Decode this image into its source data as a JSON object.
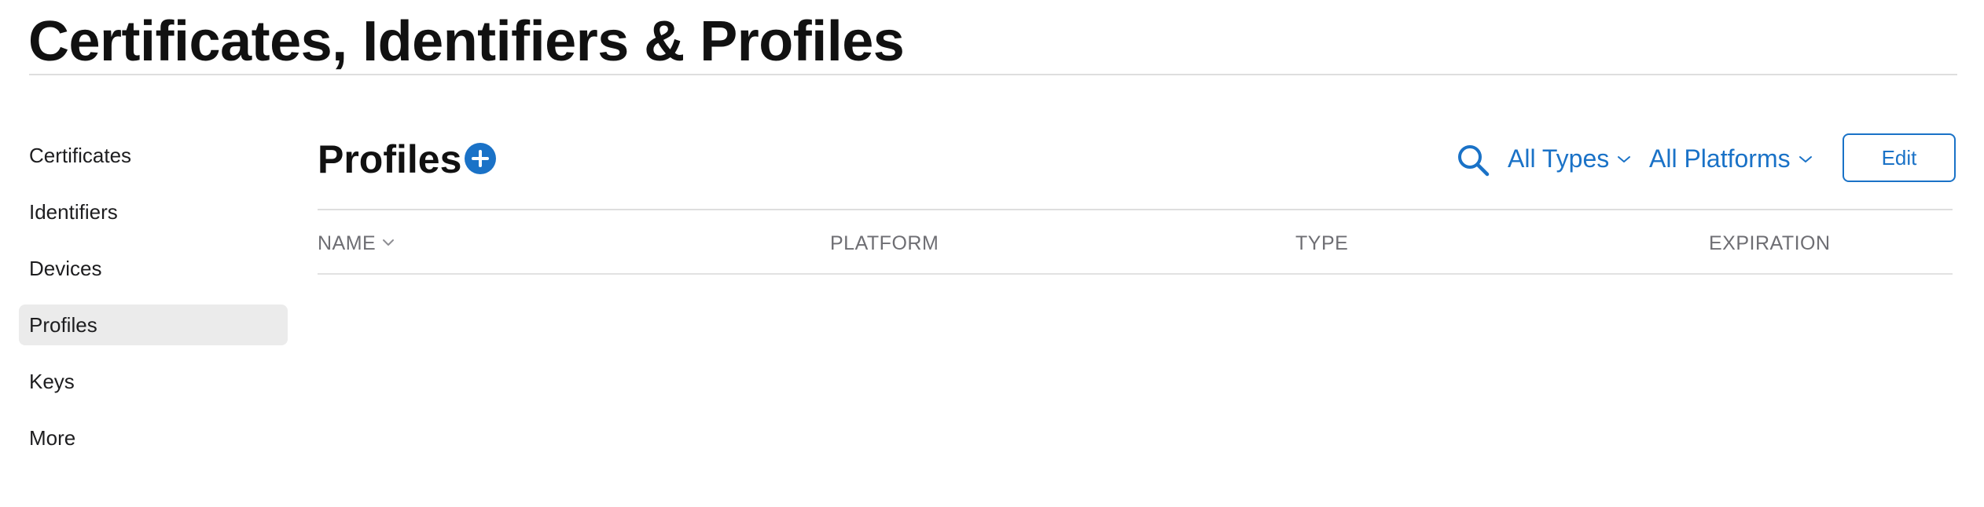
{
  "page": {
    "title": "Certificates, Identifiers & Profiles"
  },
  "sidebar": {
    "items": [
      {
        "label": "Certificates",
        "active": false
      },
      {
        "label": "Identifiers",
        "active": false
      },
      {
        "label": "Devices",
        "active": false
      },
      {
        "label": "Profiles",
        "active": true
      },
      {
        "label": "Keys",
        "active": false
      },
      {
        "label": "More",
        "active": false
      }
    ]
  },
  "main": {
    "section_title": "Profiles",
    "add_icon": "plus-circle-icon",
    "search_icon": "search-icon",
    "filters": {
      "types_label": "All Types",
      "platforms_label": "All Platforms"
    },
    "edit_label": "Edit",
    "table": {
      "columns": [
        "NAME",
        "PLATFORM",
        "TYPE",
        "EXPIRATION"
      ],
      "sort_column": "NAME",
      "rows": []
    }
  },
  "colors": {
    "accent": "#1a72c7",
    "active_sidebar_bg": "#ebebeb",
    "divider": "#dedede",
    "column_header_text": "#6e6e73"
  }
}
